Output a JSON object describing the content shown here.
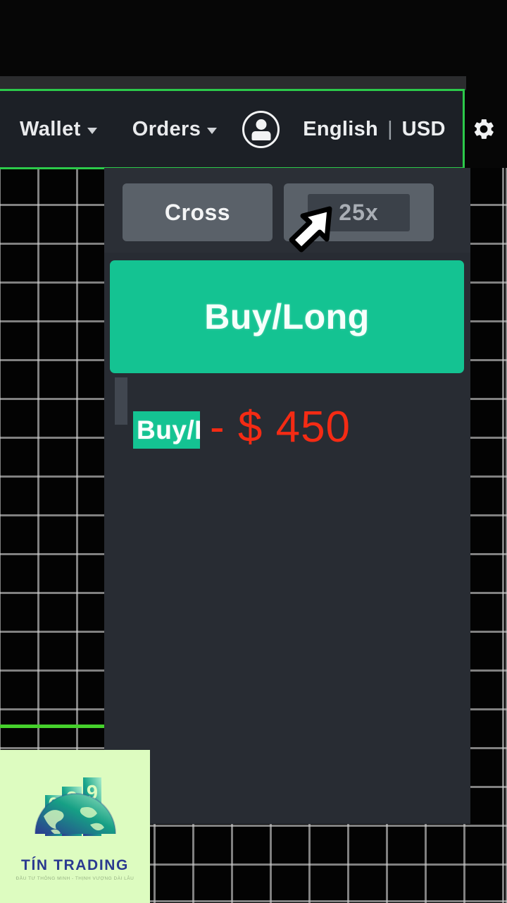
{
  "navbar": {
    "wallet_label": "Wallet",
    "orders_label": "Orders",
    "language_label": "English",
    "separator": "|",
    "currency_label": "USD",
    "account_icon": "account-circle-icon",
    "settings_icon": "gear-icon",
    "border_color": "#2cc94a",
    "background": "#1c2026"
  },
  "order_panel": {
    "margin_mode_label": "Cross",
    "leverage_label": "25x",
    "buy_button_label": "Buy/Long",
    "buy_button_color": "#14c392",
    "position": {
      "side_badge": "Buy/Long",
      "side_badge_visible": "Buy",
      "dash": "-",
      "amount": "$ 450",
      "amount_color": "#f42b14"
    }
  },
  "chart": {
    "price_line_color": "#46d12c",
    "grid_color": "#cdcdcd",
    "background": "#030303"
  },
  "watermark": {
    "brand": "TÍN TRADING",
    "tagline": "ĐẦU TƯ THÔNG MINH - THỊNH VƯỢNG DÀI LÂU",
    "digits": [
      "0",
      "2",
      "9"
    ],
    "background": "#ddfcc0",
    "text_color": "#2b3a90"
  },
  "cursor": {
    "icon": "mouse-pointer-arrow-icon"
  }
}
